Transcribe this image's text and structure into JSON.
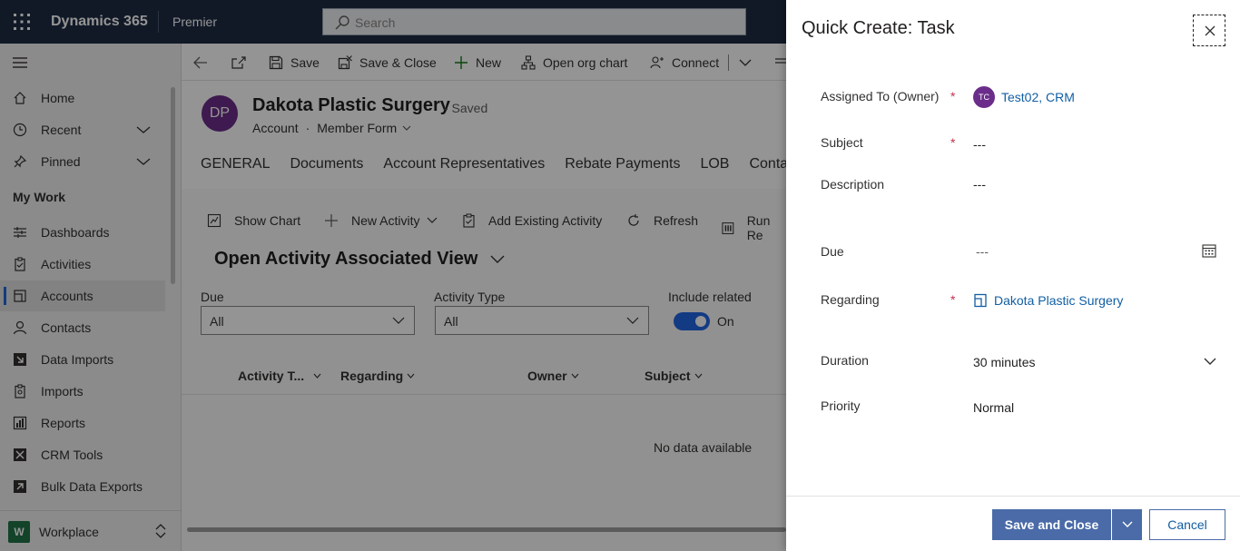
{
  "topbar": {
    "app_name": "Dynamics 365",
    "environment": "Premier",
    "search_placeholder": "Search"
  },
  "sidebar": {
    "items": [
      {
        "label": "Home",
        "icon": "home-icon"
      },
      {
        "label": "Recent",
        "icon": "clock-icon"
      },
      {
        "label": "Pinned",
        "icon": "pin-icon"
      }
    ],
    "section_title": "My Work",
    "work_items": [
      {
        "label": "Dashboards",
        "icon": "dashboard-icon"
      },
      {
        "label": "Activities",
        "icon": "clipboard-icon"
      },
      {
        "label": "Accounts",
        "icon": "account-icon",
        "active": true
      },
      {
        "label": "Contacts",
        "icon": "person-icon"
      },
      {
        "label": "Data Imports",
        "icon": "import-icon"
      },
      {
        "label": "Imports",
        "icon": "import-list-icon"
      },
      {
        "label": "Reports",
        "icon": "report-icon"
      },
      {
        "label": "CRM Tools",
        "icon": "tools-icon"
      },
      {
        "label": "Bulk Data Exports",
        "icon": "export-icon"
      }
    ],
    "workspace": {
      "badge": "W",
      "name": "Workplace"
    }
  },
  "commandbar": {
    "save": "Save",
    "save_close": "Save & Close",
    "new": "New",
    "org_chart": "Open org chart",
    "connect": "Connect"
  },
  "record": {
    "initials": "DP",
    "name": "Dakota Plastic Surgery",
    "status": "- Saved",
    "entity": "Account",
    "dot": "·",
    "form": "Member Form"
  },
  "tabs": [
    "GENERAL",
    "Documents",
    "Account Representatives",
    "Rebate Payments",
    "LOB",
    "Contact A"
  ],
  "grid": {
    "show_chart": "Show Chart",
    "new_activity": "New Activity",
    "add_existing": "Add Existing Activity",
    "refresh": "Refresh",
    "run_report": "Run Re",
    "view_title": "Open Activity Associated View",
    "filters": {
      "due_label": "Due",
      "due_value": "All",
      "type_label": "Activity Type",
      "type_value": "All",
      "related_label": "Include related",
      "related_value": "On"
    },
    "columns": [
      "Activity T...",
      "Regarding",
      "Owner",
      "Subject"
    ],
    "empty_text": "No data available"
  },
  "quick_create": {
    "title": "Quick Create: Task",
    "fields": {
      "assigned_label": "Assigned To (Owner)",
      "assigned_initials": "TC",
      "assigned_value": "Test02, CRM",
      "subject_label": "Subject",
      "subject_value": "---",
      "description_label": "Description",
      "description_value": "---",
      "due_label": "Due",
      "due_value": "---",
      "regarding_label": "Regarding",
      "regarding_value": "Dakota Plastic Surgery",
      "duration_label": "Duration",
      "duration_value": "30 minutes",
      "priority_label": "Priority",
      "priority_value": "Normal"
    },
    "required_mark": "*",
    "save_close": "Save and Close",
    "cancel": "Cancel"
  },
  "colors": {
    "topbar": "#1e2b44",
    "accent": "#2266e3",
    "link": "#115ea3",
    "primary_button": "#4a6ba8",
    "avatar": "#6b2d8a",
    "required": "#c4314b"
  }
}
